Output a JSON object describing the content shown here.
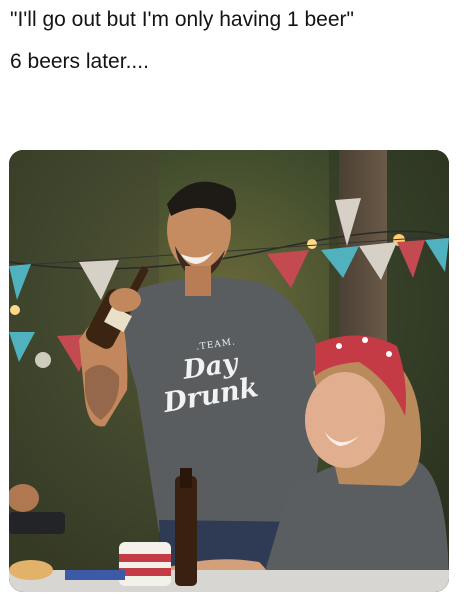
{
  "post": {
    "caption_line1": "\"I'll go out but I'm only having 1 beer\"",
    "caption_line2": "6 beers later...."
  },
  "photo": {
    "shirt_text_top": ".TEAM.",
    "shirt_text_mid": "Day",
    "shirt_text_bottom": "Drunk"
  },
  "colors": {
    "shirt": "#5a5d5f",
    "foliage": "#3e4a2e",
    "bunting": [
      "#c44a52",
      "#4fb2be",
      "#d6d0c6"
    ]
  }
}
